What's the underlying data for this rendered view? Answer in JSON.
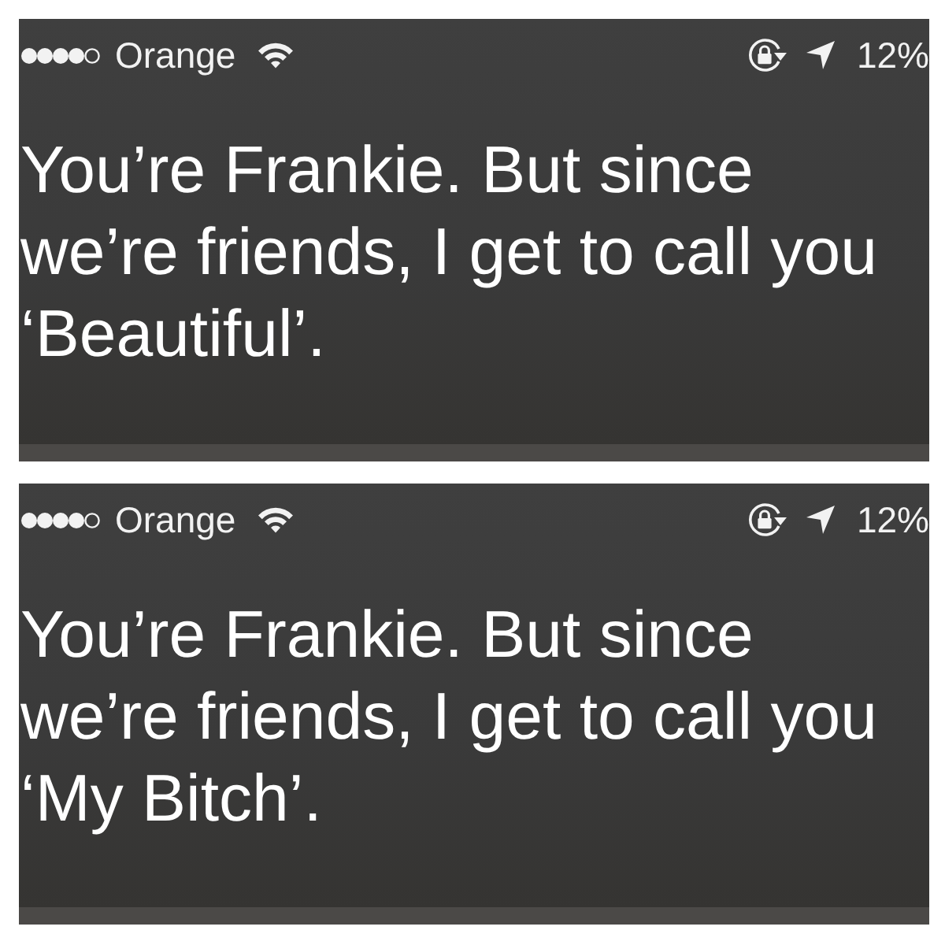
{
  "screens": [
    {
      "status_bar": {
        "carrier": "Orange",
        "battery": "12%"
      },
      "message": "You’re Frankie. But since we’re friends, I get to call you ‘Beautiful’."
    },
    {
      "status_bar": {
        "carrier": "Orange",
        "battery": "12%"
      },
      "message": "You’re Frankie. But since we’re friends, I get to call you ‘My Bitch’."
    }
  ]
}
